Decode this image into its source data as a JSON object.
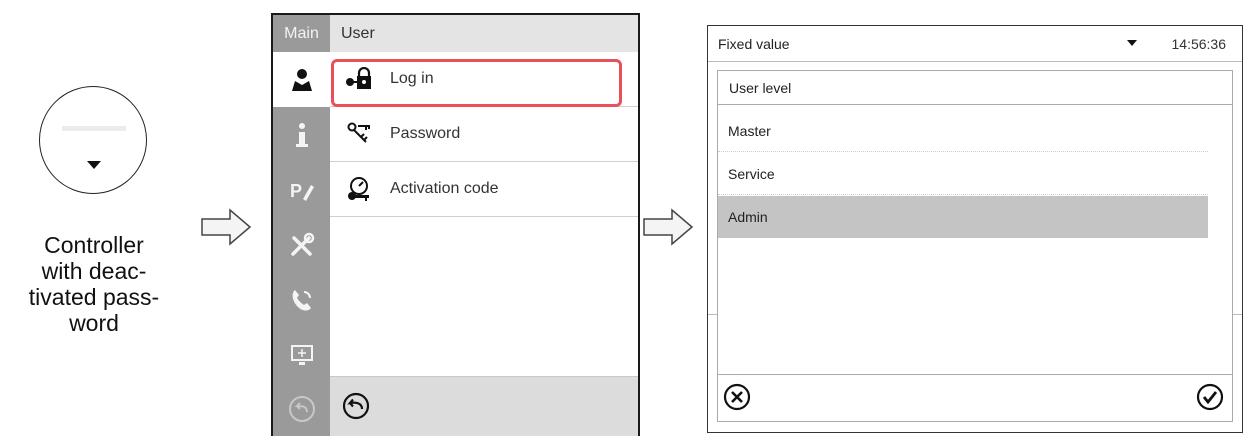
{
  "panel1": {
    "caption_lines": [
      "Controller",
      "with deac-",
      "tivated pass-",
      "word"
    ]
  },
  "panel2": {
    "sidebar_title": "Main",
    "sidebar_icons": [
      "user-icon",
      "info-icon",
      "program-edit-icon",
      "tools-icon",
      "phone-service-icon",
      "display-icon"
    ],
    "title": "User",
    "items": [
      {
        "label": "Log in",
        "icon": "login-lock-icon"
      },
      {
        "label": "Password",
        "icon": "keys-icon"
      },
      {
        "label": "Activation code",
        "icon": "activation-key-icon"
      }
    ],
    "back_icon": "back-arrow-icon",
    "highlight_color": "#e8515a"
  },
  "panel3": {
    "header_title": "Fixed value",
    "time": "14:56:36",
    "dialog_title": "User level",
    "options": [
      {
        "label": "Master",
        "selected": false
      },
      {
        "label": "Service",
        "selected": false
      },
      {
        "label": "Admin",
        "selected": true
      }
    ],
    "cancel_icon": "cancel-circle-icon",
    "confirm_icon": "confirm-check-icon"
  }
}
